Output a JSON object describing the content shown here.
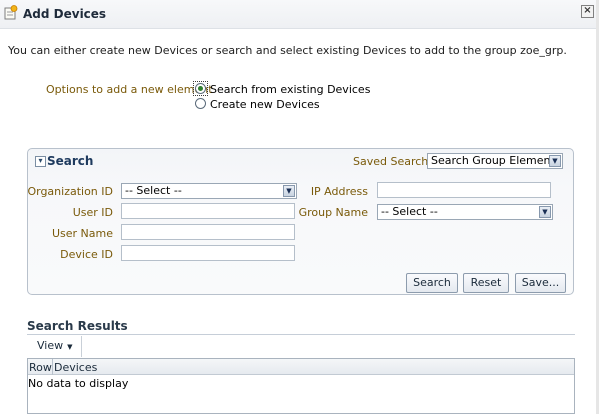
{
  "window": {
    "title": "Add Devices",
    "close_glyph": "×"
  },
  "intro_text": "You can either create new Devices or search and select existing Devices to add to the group zoe_grp.",
  "options": {
    "label": "Options to add a new element",
    "choices": [
      {
        "label": "Search from existing Devices",
        "selected": true
      },
      {
        "label": "Create new Devices",
        "selected": false
      }
    ]
  },
  "search": {
    "header": "Search",
    "saved_search_label": "Saved Search",
    "saved_search_value": "Search Group Elements",
    "fields": {
      "organization_id": {
        "label": "Organization ID",
        "value": "-- Select --"
      },
      "user_id": {
        "label": "User ID",
        "value": ""
      },
      "user_name": {
        "label": "User Name",
        "value": ""
      },
      "device_id": {
        "label": "Device ID",
        "value": ""
      },
      "ip_address": {
        "label": "IP Address",
        "value": ""
      },
      "group_name": {
        "label": "Group Name",
        "value": "-- Select --"
      }
    },
    "buttons": {
      "search": "Search",
      "reset": "Reset",
      "save": "Save..."
    }
  },
  "results": {
    "title": "Search Results",
    "view_menu": "View",
    "columns": [
      "Row",
      "Devices"
    ],
    "empty_text": "No data to display"
  },
  "colors": {
    "field_label": "#7a5a0a",
    "header_blue": "#1e3a5e",
    "panel_border": "#b8c1cc"
  },
  "icons": {
    "title_icon": "add-device-icon",
    "close_icon": "close-icon",
    "collapse_icon": "collapse-toggle-icon",
    "dropdown_icon": "chevron-down-icon"
  }
}
